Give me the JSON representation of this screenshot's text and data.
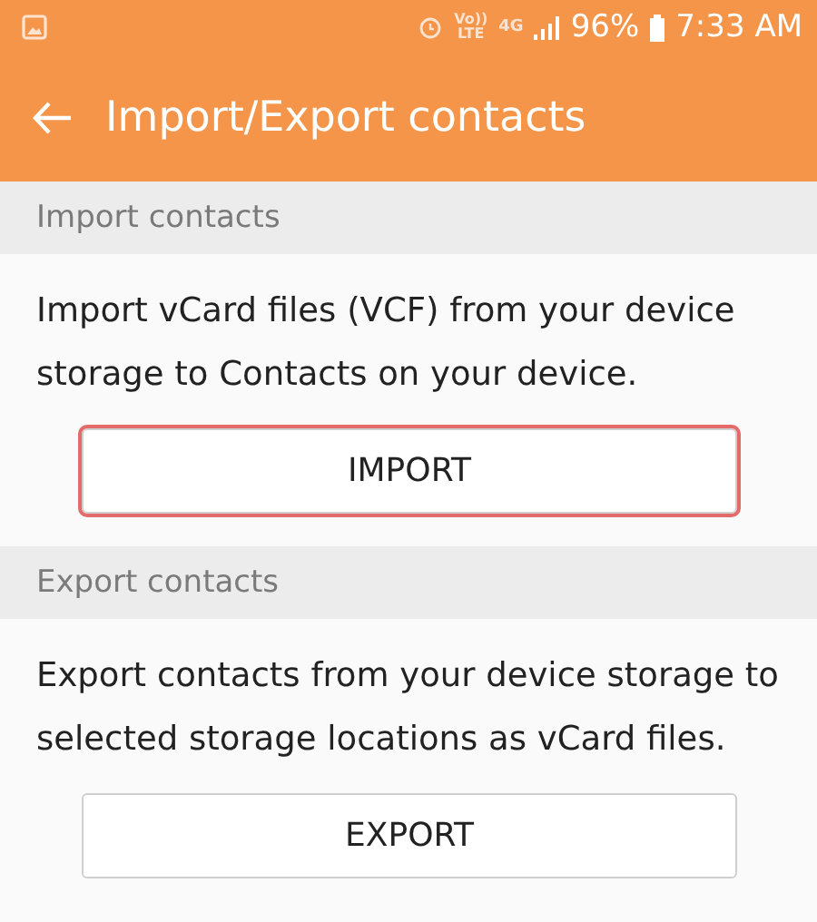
{
  "status_bar": {
    "volte": [
      "Vo))",
      "LTE"
    ],
    "network": "4G",
    "battery": "96%",
    "time": "7:33 AM"
  },
  "header": {
    "title": "Import/Export contacts"
  },
  "sections": [
    {
      "heading": "Import contacts",
      "description": "Import vCard files (VCF) from your device storage to Contacts on your device.",
      "button": {
        "label": "IMPORT",
        "focused": true
      }
    },
    {
      "heading": "Export contacts",
      "description": "Export contacts from your device storage to selected storage locations as vCard files.",
      "button": {
        "label": "EXPORT",
        "focused": false
      }
    }
  ]
}
